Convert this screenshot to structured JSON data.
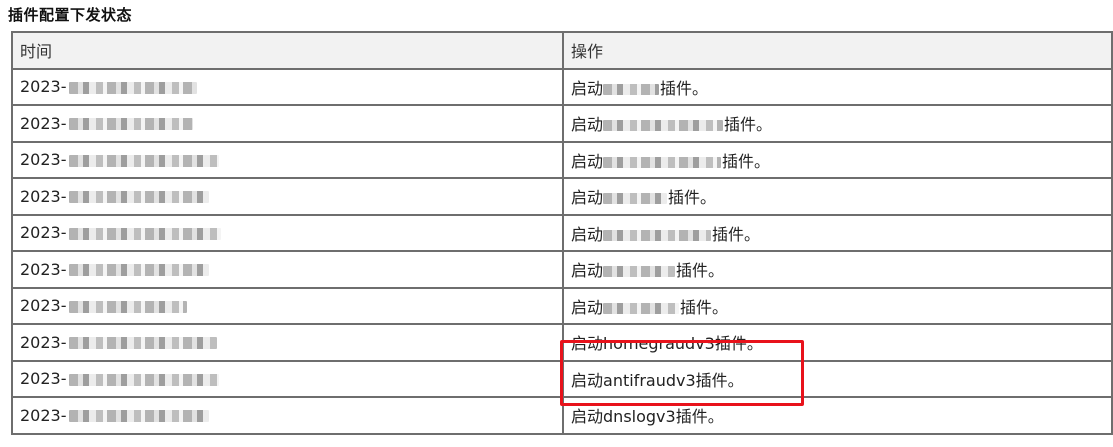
{
  "section_title": "插件配置下发状态",
  "table": {
    "headers": [
      "时间",
      "操作"
    ],
    "rows": [
      {
        "time": "2023-",
        "op_prefix": "启动",
        "op_name": "",
        "op_suffix": "插件。",
        "redacted": true
      },
      {
        "time": "2023-",
        "op_prefix": "启动",
        "op_name": "",
        "op_suffix": "插件。",
        "redacted": true
      },
      {
        "time": "2023-",
        "op_prefix": "启动",
        "op_name": "",
        "op_suffix": "插件。",
        "redacted": true
      },
      {
        "time": "2023-",
        "op_prefix": "启动",
        "op_name": "",
        "op_suffix": "插件。",
        "redacted": true
      },
      {
        "time": "2023-",
        "op_prefix": "启动",
        "op_name": "",
        "op_suffix": "插件。",
        "redacted": true
      },
      {
        "time": "2023-",
        "op_prefix": "启动",
        "op_name": "",
        "op_suffix": "插件。",
        "redacted": true
      },
      {
        "time": "2023-",
        "op_prefix": "启动",
        "op_name": "",
        "op_suffix": "插件。",
        "redacted": true
      },
      {
        "time": "2023-",
        "op_prefix": "启动",
        "op_name": "homegraudv3",
        "op_suffix": "插件。",
        "redacted": false
      },
      {
        "time": "2023-",
        "op_prefix": "启动",
        "op_name": "antifraudv3",
        "op_suffix": "插件。",
        "redacted": false
      },
      {
        "time": "2023-",
        "op_prefix": "启动",
        "op_name": "dnslogv3",
        "op_suffix": "插件。",
        "redacted": false
      }
    ]
  },
  "highlight_color": "#e8121b"
}
